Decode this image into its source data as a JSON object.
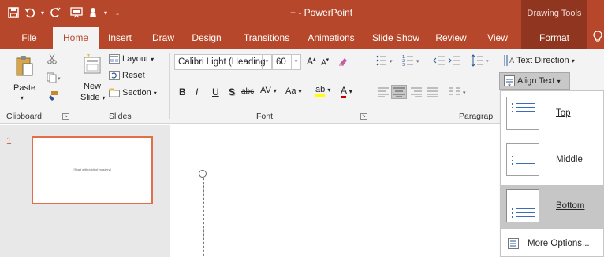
{
  "title_bar": {
    "title": "+ - PowerPoint",
    "contextual_group": "Drawing Tools",
    "qat": [
      "save-icon",
      "undo-icon",
      "redo-icon",
      "slideshow-icon",
      "touch-mode-icon"
    ]
  },
  "tabs": {
    "file": "File",
    "home": "Home",
    "insert": "Insert",
    "draw": "Draw",
    "design": "Design",
    "transitions": "Transitions",
    "animations": "Animations",
    "slide_show": "Slide Show",
    "review": "Review",
    "view": "View",
    "format": "Format"
  },
  "ribbon": {
    "clipboard": {
      "label": "Clipboard",
      "paste": "Paste"
    },
    "slides": {
      "label": "Slides",
      "new_slide_line1": "New",
      "new_slide_line2": "Slide",
      "layout": "Layout",
      "reset": "Reset",
      "section": "Section"
    },
    "font": {
      "label": "Font",
      "font_name": "Calibri Light (Heading",
      "font_size": "60",
      "bold": "B",
      "italic": "I",
      "underline": "U",
      "shadow": "S",
      "strike": "abc",
      "spacing": "AV",
      "case": "Aa",
      "highlight": "ab",
      "font_color": "A",
      "grow": "A",
      "shrink": "A"
    },
    "paragraph": {
      "label": "Paragrap",
      "text_direction": "Text Direction",
      "align_text": "Align Text"
    }
  },
  "thumbnails": {
    "slide_number": "1",
    "slide_text": "[Start with a bit of mystery]"
  },
  "align_menu": {
    "top": "Top",
    "middle": "Middle",
    "bottom": "Bottom",
    "more_options": "More Options..."
  },
  "colors": {
    "accent": "#b7472a",
    "contextual": "#8f3520",
    "ribbon": "#f3f3f3",
    "thumb_border": "#e16f4c"
  }
}
